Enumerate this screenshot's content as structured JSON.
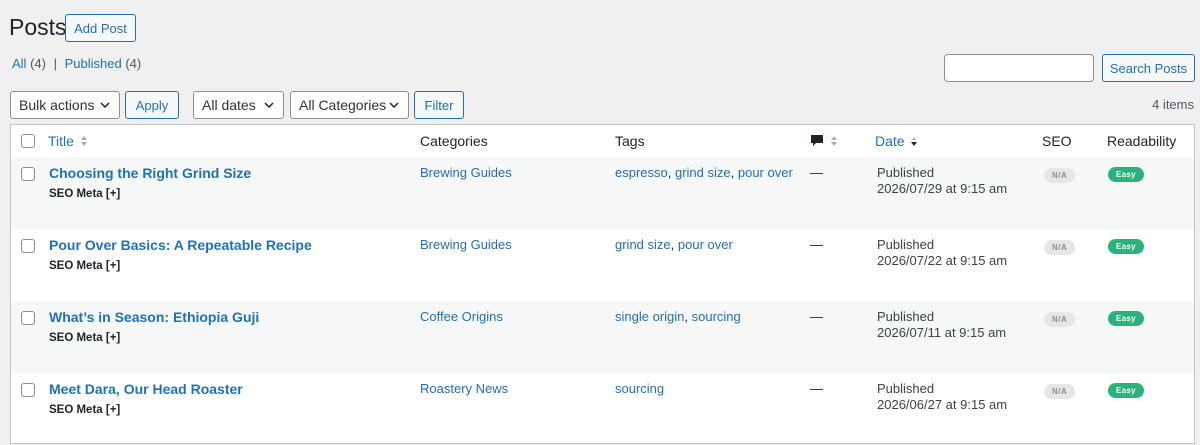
{
  "header": {
    "title": "Posts",
    "add_label": "Add Post"
  },
  "filters_nav": {
    "all_label": "All",
    "all_count": "(4)",
    "separator": "|",
    "published_label": "Published",
    "published_count": "(4)"
  },
  "search": {
    "value": "",
    "placeholder": "",
    "button_label": "Search Posts"
  },
  "toolbar": {
    "bulk_actions": "Bulk actions",
    "apply_label": "Apply",
    "dates": "All dates",
    "categories": "All Categories",
    "filter_label": "Filter",
    "items_count": "4 items"
  },
  "columns": {
    "title": "Title",
    "categories": "Categories",
    "tags": "Tags",
    "date": "Date",
    "seo": "SEO",
    "readability": "Readability"
  },
  "rows": [
    {
      "title": "Choosing the Right Grind Size",
      "seo_meta": "SEO Meta [+]",
      "category": "Brewing Guides",
      "tags": [
        "espresso",
        "grind size",
        "pour over"
      ],
      "comments": "—",
      "status": "Published",
      "date": "2026/07/29 at 9:15 am",
      "seo": "N/A",
      "readability": "Easy"
    },
    {
      "title": "Pour Over Basics: A Repeatable Recipe",
      "seo_meta": "SEO Meta [+]",
      "category": "Brewing Guides",
      "tags": [
        "grind size",
        "pour over"
      ],
      "comments": "—",
      "status": "Published",
      "date": "2026/07/22 at 9:15 am",
      "seo": "N/A",
      "readability": "Easy"
    },
    {
      "title": "What’s in Season: Ethiopia Guji",
      "seo_meta": "SEO Meta [+]",
      "category": "Coffee Origins",
      "tags": [
        "single origin",
        "sourcing"
      ],
      "comments": "—",
      "status": "Published",
      "date": "2026/07/11 at 9:15 am",
      "seo": "N/A",
      "readability": "Easy"
    },
    {
      "title": "Meet Dara, Our Head Roaster",
      "seo_meta": "SEO Meta [+]",
      "category": "Roastery News",
      "tags": [
        "sourcing"
      ],
      "comments": "—",
      "status": "Published",
      "date": "2026/06/27 at 9:15 am",
      "seo": "N/A",
      "readability": "Easy"
    }
  ],
  "colors": {
    "link": "#2271b1",
    "easy": "#2ab27b",
    "na": "#e6e6e6"
  }
}
